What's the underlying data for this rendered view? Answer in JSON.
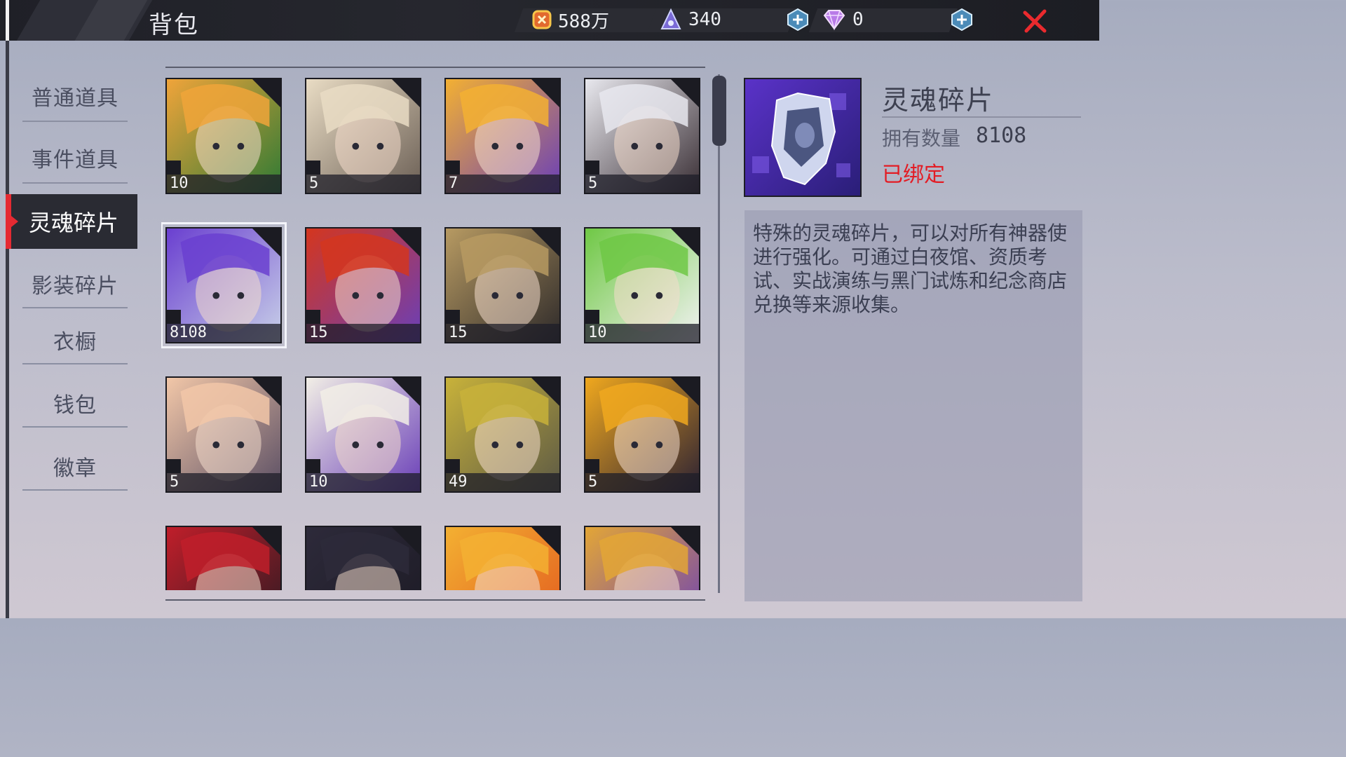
{
  "header": {
    "title": "背包",
    "currencies": [
      {
        "icon": "gold-coin-icon",
        "value": "588万"
      },
      {
        "icon": "stamina-flask-icon",
        "value": "340"
      },
      {
        "icon": "diamond-icon",
        "value": "0"
      }
    ],
    "close_icon": "close-icon"
  },
  "sidebar": {
    "items": [
      {
        "label": "普通道具",
        "active": false
      },
      {
        "label": "事件道具",
        "active": false
      },
      {
        "label": "灵魂碎片",
        "active": true
      },
      {
        "label": "影装碎片",
        "active": false
      },
      {
        "label": "衣橱",
        "active": false
      },
      {
        "label": "钱包",
        "active": false
      },
      {
        "label": "徽章",
        "active": false
      }
    ]
  },
  "grid": {
    "items": [
      {
        "qty": "10",
        "palette": [
          "#f0a43a",
          "#2e7a34"
        ]
      },
      {
        "qty": "5",
        "palette": [
          "#e9dcc4",
          "#6b5f55"
        ]
      },
      {
        "qty": "7",
        "palette": [
          "#f3b032",
          "#6a3fb8"
        ]
      },
      {
        "qty": "5",
        "palette": [
          "#e8e8ee",
          "#3a2f35"
        ]
      },
      {
        "qty": "8108",
        "palette": [
          "#6a3fd0",
          "#c8d0e8"
        ],
        "selected": true
      },
      {
        "qty": "15",
        "palette": [
          "#d4361e",
          "#6a3fb8"
        ]
      },
      {
        "qty": "15",
        "palette": [
          "#b79a62",
          "#2e2a2a"
        ]
      },
      {
        "qty": "10",
        "palette": [
          "#6fc845",
          "#f2f2f2"
        ]
      },
      {
        "qty": "5",
        "palette": [
          "#f2c7a8",
          "#5b4f64"
        ]
      },
      {
        "qty": "10",
        "palette": [
          "#f2efe6",
          "#6a3fb8"
        ]
      },
      {
        "qty": "49",
        "palette": [
          "#c8b23a",
          "#5d5a45"
        ]
      },
      {
        "qty": "5",
        "palette": [
          "#f0a81e",
          "#2d2233"
        ]
      },
      {
        "qty": "",
        "palette": [
          "#c01e2a",
          "#2a1a22"
        ]
      },
      {
        "qty": "",
        "palette": [
          "#2d2a3a",
          "#1c1a24"
        ]
      },
      {
        "qty": "",
        "palette": [
          "#f3b032",
          "#e25a1e"
        ]
      },
      {
        "qty": "",
        "palette": [
          "#e3a636",
          "#6a3fb8"
        ]
      }
    ]
  },
  "detail": {
    "name": "灵魂碎片",
    "count_label": "拥有数量",
    "count_value": "8108",
    "bound": "已绑定",
    "description": "特殊的灵魂碎片，可以对所有神器使进行强化。可通过白夜馆、资质考试、实战演练与黑门试炼和纪念商店兑换等来源收集。"
  },
  "colors": {
    "accent_red": "#e52a32",
    "bound_red": "#e31c24"
  }
}
